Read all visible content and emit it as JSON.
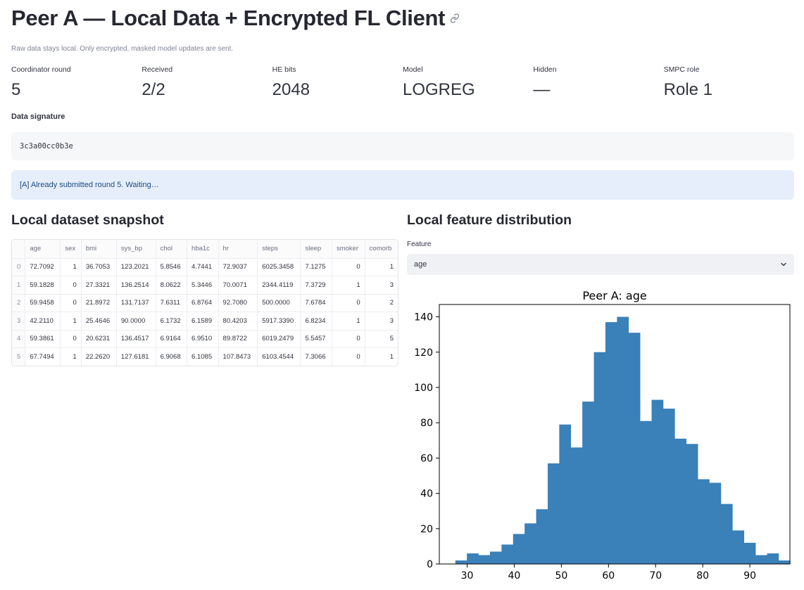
{
  "header": {
    "title": "Peer A — Local Data + Encrypted FL Client",
    "caption": "Raw data stays local. Only encrypted, masked model updates are sent."
  },
  "metrics": [
    {
      "label": "Coordinator round",
      "value": "5"
    },
    {
      "label": "Received",
      "value": "2/2"
    },
    {
      "label": "HE bits",
      "value": "2048"
    },
    {
      "label": "Model",
      "value": "LOGREG"
    },
    {
      "label": "Hidden",
      "value": "—"
    },
    {
      "label": "SMPC role",
      "value": "Role 1"
    }
  ],
  "signature": {
    "label": "Data signature",
    "value": "3c3a00cc0b3e"
  },
  "info": "[A] Already submitted round 5. Waiting…",
  "snapshot": {
    "title": "Local dataset snapshot",
    "columns": [
      "",
      "age",
      "sex",
      "bmi",
      "sys_bp",
      "chol",
      "hba1c",
      "hr",
      "steps",
      "sleep",
      "smoker",
      "comorb"
    ],
    "rows": [
      [
        "0",
        "72.7092",
        "1",
        "36.7053",
        "123.2021",
        "5.8546",
        "4.7441",
        "72.9037",
        "6025.3458",
        "7.1275",
        "0",
        "1"
      ],
      [
        "1",
        "59.1828",
        "0",
        "27.3321",
        "136.2514",
        "8.0622",
        "5.3446",
        "70.0071",
        "2344.4119",
        "7.3729",
        "1",
        "3"
      ],
      [
        "2",
        "59.9458",
        "0",
        "21.8972",
        "131.7137",
        "7.6311",
        "6.8764",
        "92.7080",
        "500.0000",
        "7.6784",
        "0",
        "2"
      ],
      [
        "3",
        "42.2110",
        "1",
        "25.4646",
        "90.0000",
        "6.1732",
        "6.1589",
        "80.4203",
        "5917.3390",
        "6.8234",
        "1",
        "3"
      ],
      [
        "4",
        "59.3861",
        "0",
        "20.6231",
        "136.4517",
        "6.9164",
        "6.9510",
        "89.8722",
        "6019.2479",
        "5.5457",
        "0",
        "5"
      ],
      [
        "5",
        "67.7494",
        "1",
        "22.2620",
        "127.6181",
        "6.9068",
        "6.1085",
        "107.8473",
        "6103.4544",
        "7.3066",
        "0",
        "1"
      ]
    ]
  },
  "distribution": {
    "title": "Local feature distribution",
    "select_label": "Feature",
    "select_value": "age"
  },
  "chart_data": {
    "type": "bar",
    "title": "Peer A: age",
    "xlabel": "",
    "ylabel": "",
    "bin_start": 27.5,
    "bin_width": 2.45,
    "values": [
      2,
      6,
      5,
      7,
      11,
      17,
      23,
      31,
      57,
      79,
      66,
      92,
      120,
      137,
      140,
      131,
      81,
      93,
      88,
      71,
      68,
      48,
      46,
      34,
      19,
      12,
      5,
      6,
      2
    ],
    "xticks": [
      30,
      40,
      50,
      60,
      70,
      80,
      90
    ],
    "yticks": [
      0,
      20,
      40,
      60,
      80,
      100,
      120,
      140
    ],
    "xlim": [
      24.1,
      98.5
    ],
    "ylim": [
      0,
      147
    ],
    "bar_color": "#3a80b9"
  },
  "colors": {
    "info_bg": "#e6eefb",
    "info_text": "#1c4a83",
    "code_bg": "#f6f7f9"
  }
}
